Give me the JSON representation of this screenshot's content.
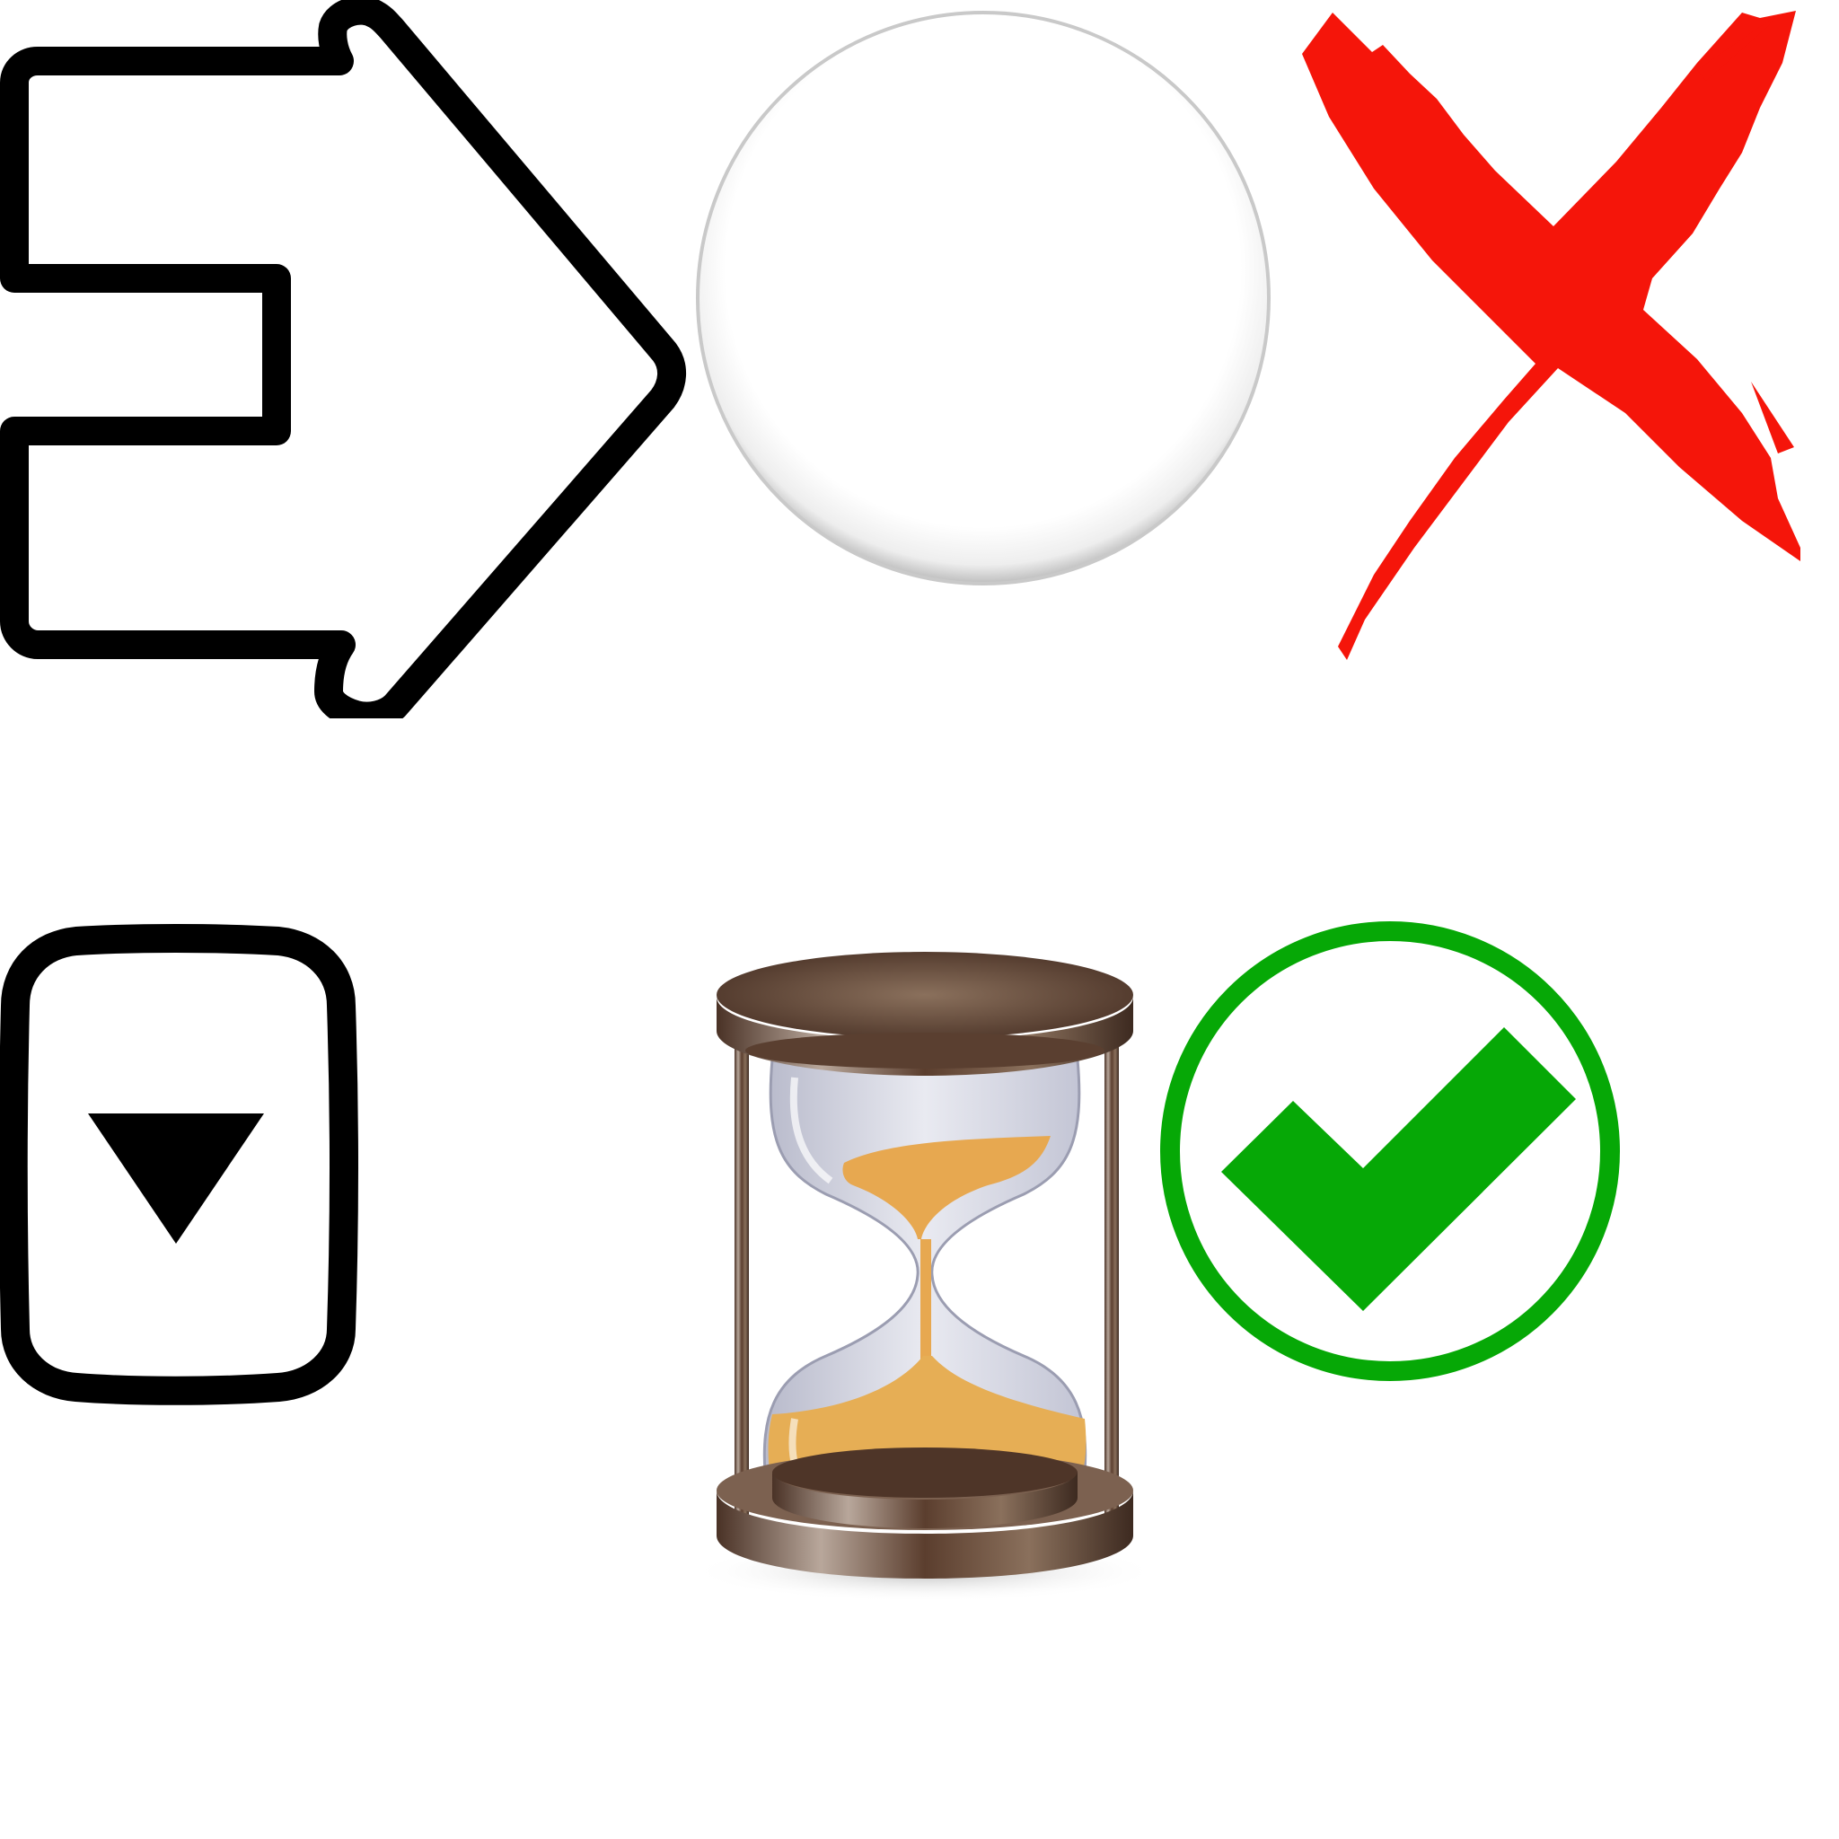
{
  "icons": [
    {
      "name": "arrow-right-outline-icon",
      "color": "#000000",
      "interactable": true
    },
    {
      "name": "glossy-bubble-icon",
      "color": "#ffffff",
      "interactable": true
    },
    {
      "name": "red-x-close-icon",
      "color": "#f5150a",
      "interactable": true
    },
    {
      "name": "dropdown-triangle-button-icon",
      "color": "#000000",
      "interactable": true
    },
    {
      "name": "hourglass-icon",
      "color": "#e7a850",
      "interactable": false
    },
    {
      "name": "green-checkmark-icon",
      "color": "#06a806",
      "interactable": true
    }
  ],
  "colors": {
    "background": "#ffffff",
    "outline": "#000000",
    "cross_red": "#f5150a",
    "check_green": "#06a806",
    "wood_dark": "#4a3226",
    "wood_light": "#8a705c",
    "sand": "#e7a850",
    "glass": "#cfd0dd"
  }
}
